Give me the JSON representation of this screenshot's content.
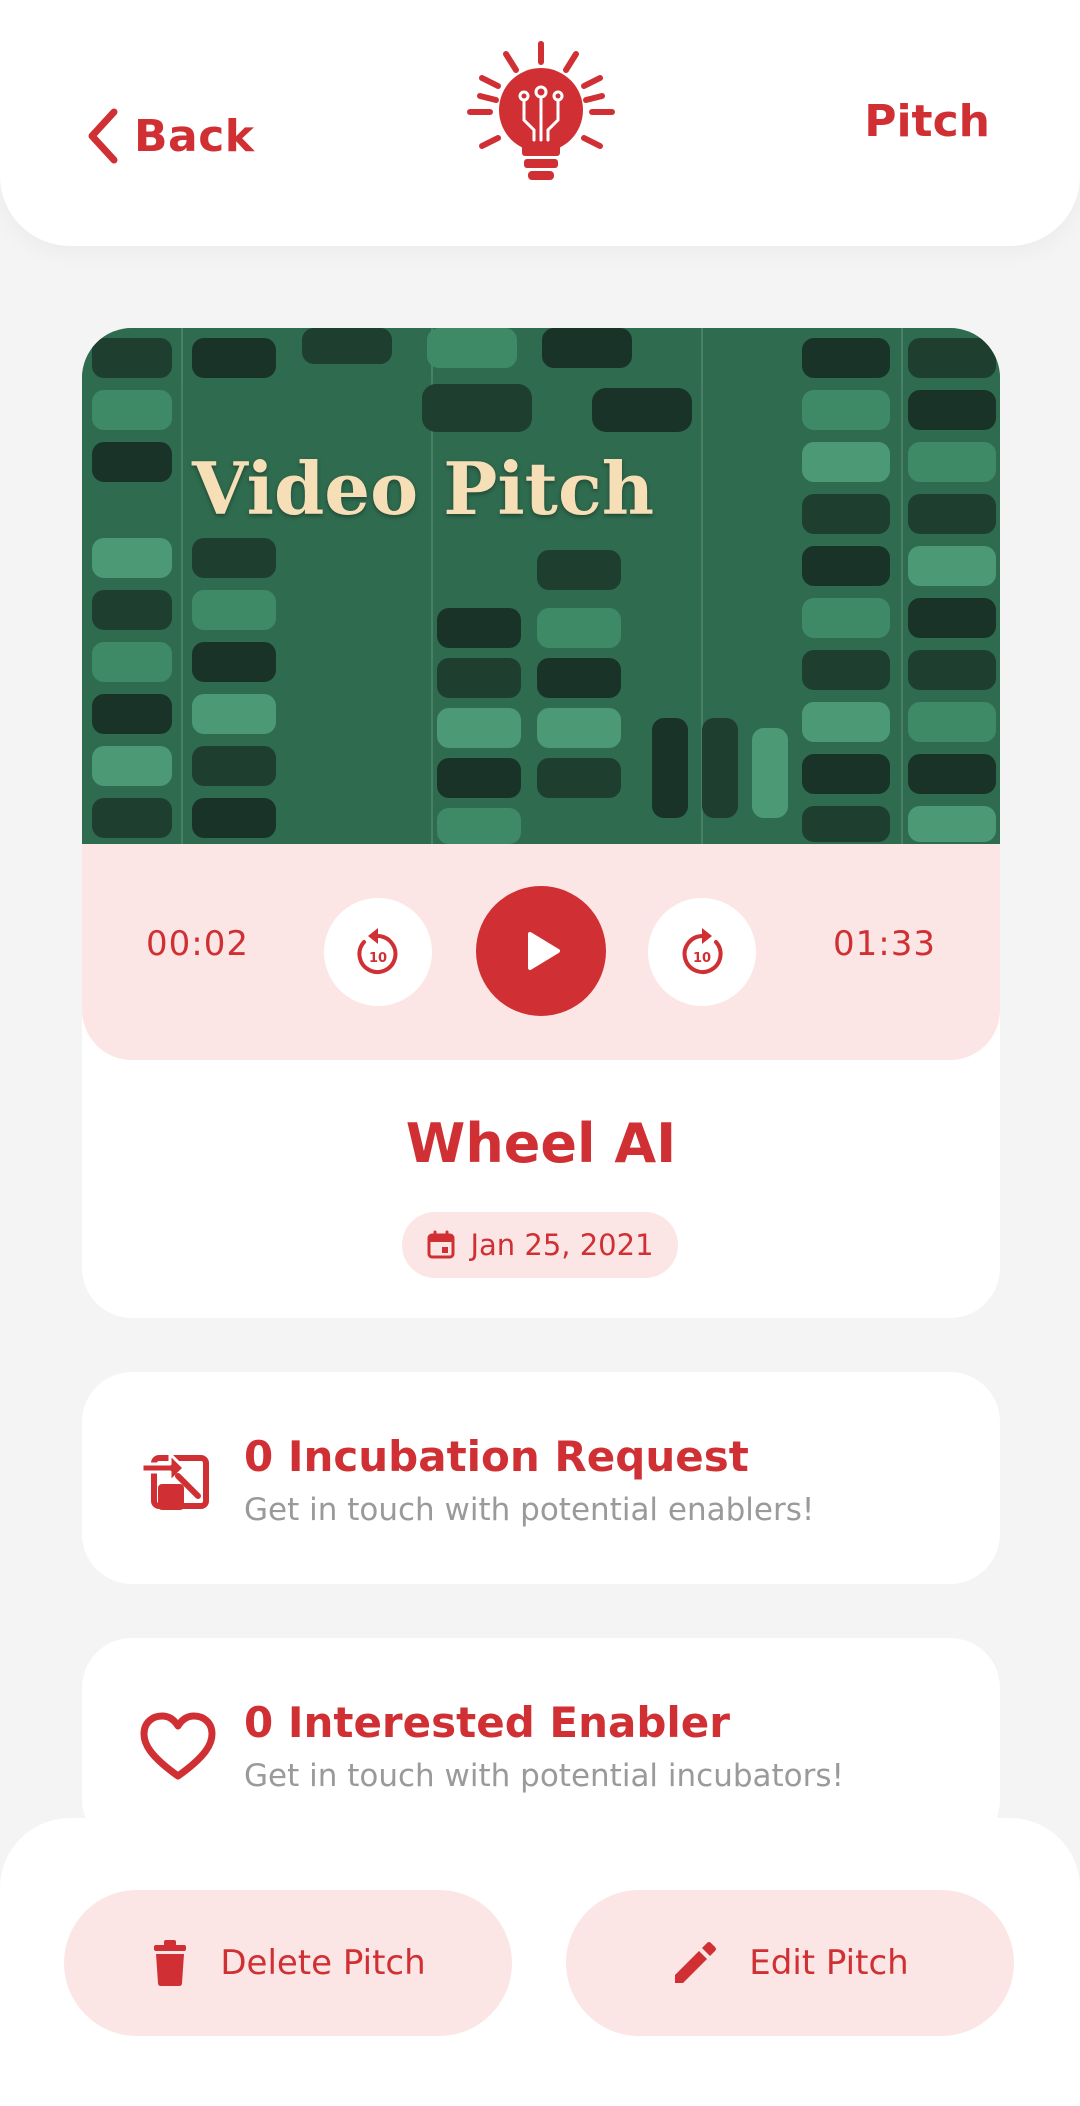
{
  "header": {
    "back_label": "Back",
    "title": "Pitch",
    "logo_icon": "lightbulb-circuit-icon"
  },
  "video": {
    "overlay_title": "Video Pitch",
    "current_time": "00:02",
    "total_time": "01:33",
    "rewind_icon": "rewind-10-icon",
    "forward_icon": "forward-10-icon",
    "play_icon": "play-icon",
    "skip_seconds": "10"
  },
  "pitch": {
    "name": "Wheel AI",
    "date": "Jan 25, 2021",
    "date_icon": "calendar-icon"
  },
  "stats": [
    {
      "title": "0 Incubation Request",
      "subtitle": "Get in touch with potential enablers!",
      "icon": "incubation-request-icon"
    },
    {
      "title": "0 Interested Enabler",
      "subtitle": "Get in touch with potential incubators!",
      "icon": "heart-icon"
    }
  ],
  "actions": {
    "delete_label": "Delete Pitch",
    "edit_label": "Edit Pitch",
    "delete_icon": "trash-icon",
    "edit_icon": "pencil-icon"
  },
  "colors": {
    "accent": "#d03034",
    "accent_soft": "#fbe6e5",
    "background": "#f4f4f4",
    "card": "#ffffff",
    "muted_text": "#9a9a9a",
    "video_overlay": "#2f6b4f",
    "video_title": "#f6dfb7"
  }
}
